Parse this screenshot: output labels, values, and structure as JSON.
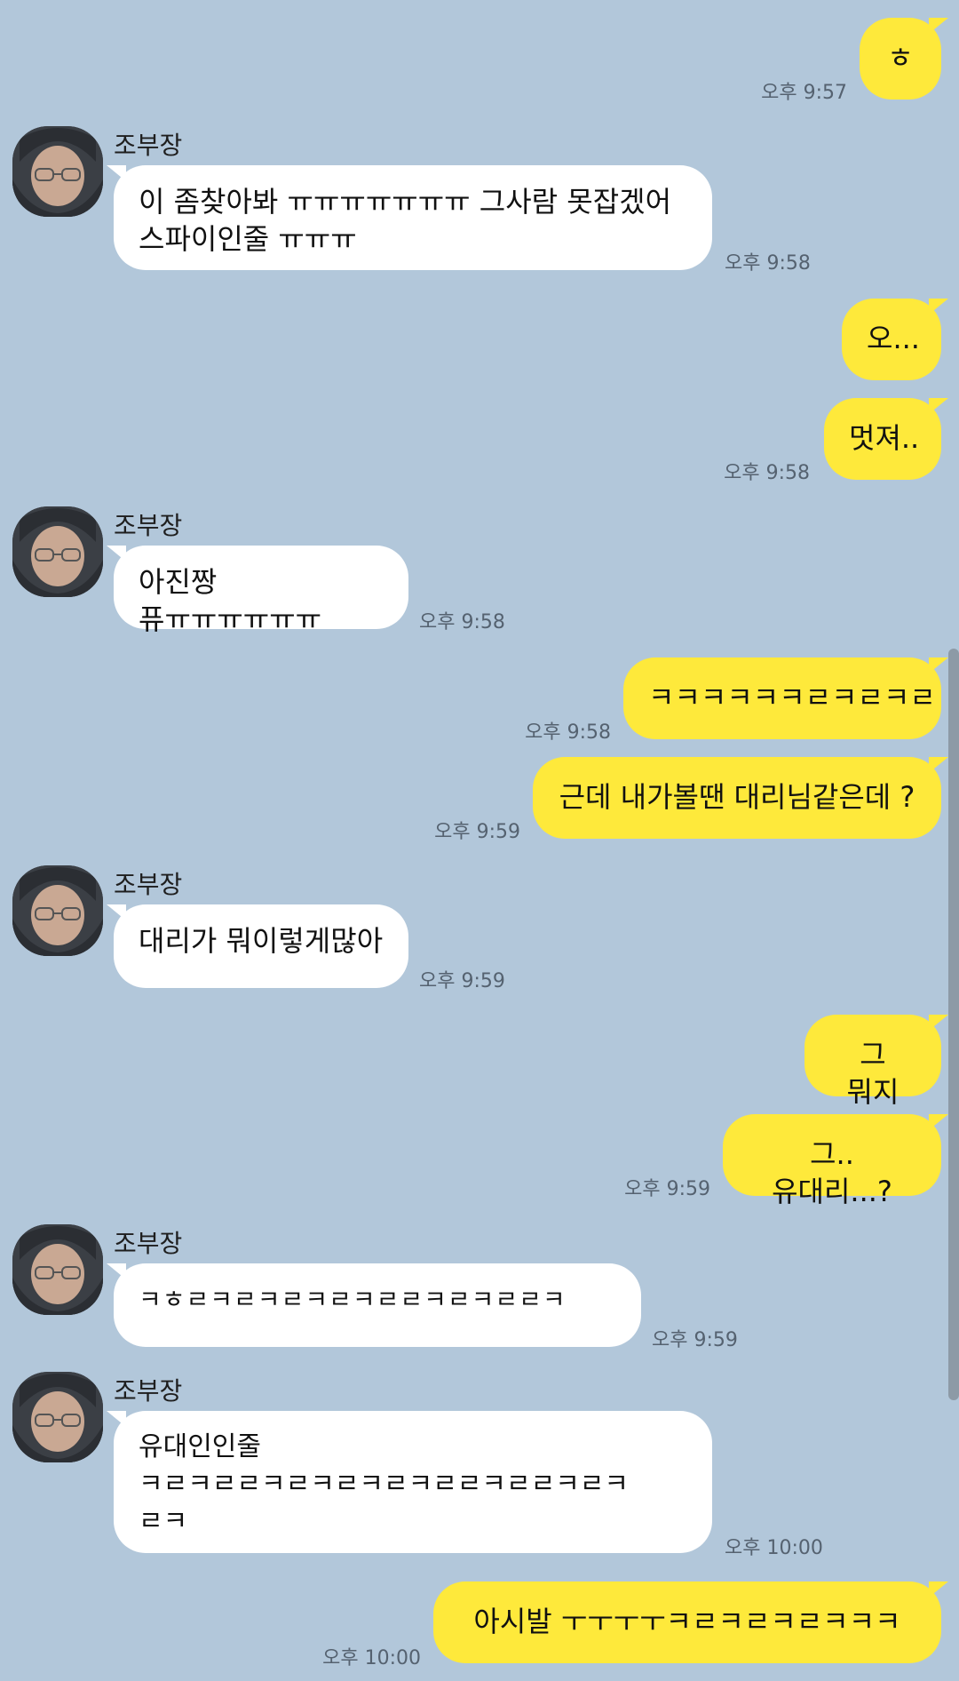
{
  "chat": {
    "other_name": "조부장",
    "messages": [
      {
        "text": "ㅎ",
        "time": "오후 9:57"
      },
      {
        "text": "이 좀찾아봐 ㅠㅠㅠㅠㅠㅠㅠ 그사람 못잡겠어\n스파이인줄 ㅠㅠㅠ",
        "time": "오후 9:58"
      },
      {
        "text": "오..."
      },
      {
        "text": "멋져..",
        "time": "오후 9:58"
      },
      {
        "text": "아진짱 퓨ㅠㅠㅠㅠㅠㅠ",
        "time": "오후 9:58"
      },
      {
        "text": "ㅋㅋㅋㅋㅋㅋㄹㅋㄹㅋㄹ",
        "time": "오후 9:58"
      },
      {
        "text": "근데 내가볼땐 대리님같은데 ?",
        "time": "오후 9:59"
      },
      {
        "text": "대리가 뭐이렇게많아",
        "time": "오후 9:59"
      },
      {
        "text": "그 뭐지"
      },
      {
        "text": "그.. 유대리...?",
        "time": "오후 9:59"
      },
      {
        "text": "ㅋㅎㄹㅋㄹㅋㄹㅋㄹㅋㄹㄹㅋㄹㅋㄹㄹㅋ",
        "time": "오후 9:59"
      },
      {
        "text": "유대인인줄\nㅋㄹㅋㄹㄹㅋㄹㅋㄹㅋㄹㅋㄹㄹㅋㄹㄹㅋㄹㅋ\nㄹㅋ",
        "time": "오후 10:00"
      },
      {
        "text": "아시발 ㅜㅜㅜㅜㅋㄹㅋㄹㅋㄹㅋㅋㅋ",
        "time": "오후 10:00"
      }
    ]
  },
  "colors": {
    "background": "#b2c7da",
    "my_bubble": "#fee93b",
    "other_bubble": "#ffffff",
    "timestamp": "#556270",
    "scrollbar": "#8d9aa6"
  },
  "icons": {
    "avatar": "profile-photo-avatar"
  }
}
